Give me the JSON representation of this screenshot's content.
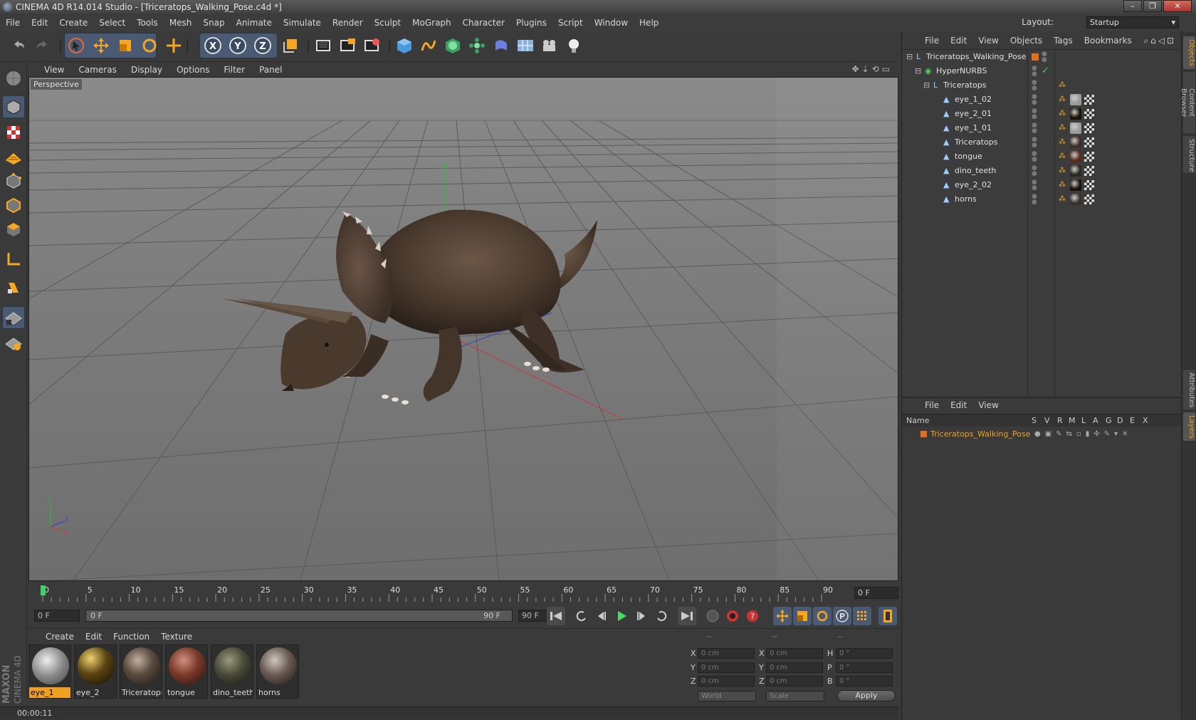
{
  "window": {
    "title": "CINEMA 4D R14.014 Studio - [Triceratops_Walking_Pose.c4d *]",
    "buttons": [
      "–",
      "❐",
      "✕"
    ]
  },
  "menubar": {
    "items": [
      "File",
      "Edit",
      "Create",
      "Select",
      "Tools",
      "Mesh",
      "Snap",
      "Animate",
      "Simulate",
      "Render",
      "Sculpt",
      "MoGraph",
      "Character",
      "Plugins",
      "Script",
      "Window",
      "Help"
    ],
    "layout_label": "Layout:",
    "layout_value": "Startup"
  },
  "toolbar": {
    "axis_labels": [
      "X",
      "Y",
      "Z"
    ],
    "icons": [
      "undo-icon",
      "redo-icon",
      "select-arrow-icon",
      "move-icon",
      "scale-icon",
      "rotate-icon",
      "live-select-icon",
      "x-axis-icon",
      "y-axis-icon",
      "z-axis-icon",
      "coordinate-system-icon",
      "render-view-icon",
      "render-picture-viewer-icon",
      "render-settings-icon",
      "cube-icon",
      "spline-icon",
      "nurbs-icon",
      "array-icon",
      "deformer-icon",
      "floor-icon",
      "camera-icon",
      "light-icon"
    ]
  },
  "viewport": {
    "menu": [
      "View",
      "Cameras",
      "Display",
      "Options",
      "Filter",
      "Panel"
    ],
    "label": "Perspective",
    "axis_x": "X",
    "axis_y": "Y",
    "axis_z": "Z"
  },
  "timeline": {
    "ticks": [
      "0",
      "5",
      "10",
      "15",
      "20",
      "25",
      "30",
      "35",
      "40",
      "45",
      "50",
      "55",
      "60",
      "65",
      "70",
      "75",
      "80",
      "85",
      "90"
    ],
    "current_frame_box": "0 F"
  },
  "transport": {
    "start_field": "0 F",
    "range_start": "0 F",
    "range_end": "90 F",
    "end_field": "90 F"
  },
  "materials": {
    "menu": [
      "Create",
      "Edit",
      "Function",
      "Texture"
    ],
    "items": [
      {
        "name": "eye_1",
        "selected": true
      },
      {
        "name": "eye_2",
        "selected": false
      },
      {
        "name": "Triceratops",
        "selected": false
      },
      {
        "name": "tongue",
        "selected": false
      },
      {
        "name": "dino_teeth",
        "selected": false
      },
      {
        "name": "horns",
        "selected": false
      }
    ]
  },
  "coordinates": {
    "headers": [
      "--",
      "--",
      "--"
    ],
    "rows": [
      {
        "l1": "X",
        "v1": "0 cm",
        "l2": "X",
        "v2": "0 cm",
        "l3": "H",
        "v3": "0 °"
      },
      {
        "l1": "Y",
        "v1": "0 cm",
        "l2": "Y",
        "v2": "0 cm",
        "l3": "P",
        "v3": "0 °"
      },
      {
        "l1": "Z",
        "v1": "0 cm",
        "l2": "Z",
        "v2": "0 cm",
        "l3": "B",
        "v3": "0 °"
      }
    ],
    "world": "World",
    "scale": "Scale",
    "apply": "Apply"
  },
  "status": {
    "time": "00:00:11"
  },
  "branding": {
    "maxon": "MAXON",
    "cinema": "CINEMA 4D"
  },
  "objects": {
    "menu": [
      "File",
      "Edit",
      "View",
      "Objects",
      "Tags",
      "Bookmarks"
    ],
    "tree": [
      {
        "name": "Triceratops_Walking_Pose",
        "level": 0
      },
      {
        "name": "HyperNURBS",
        "level": 1
      },
      {
        "name": "Triceratops",
        "level": 2
      },
      {
        "name": "eye_1_02",
        "level": 3
      },
      {
        "name": "eye_2_01",
        "level": 3
      },
      {
        "name": "eye_1_01",
        "level": 3
      },
      {
        "name": "Triceratops",
        "level": 3
      },
      {
        "name": "tongue",
        "level": 3
      },
      {
        "name": "dino_teeth",
        "level": 3
      },
      {
        "name": "eye_2_02",
        "level": 3
      },
      {
        "name": "horns",
        "level": 3
      }
    ]
  },
  "layers": {
    "menu": [
      "File",
      "Edit",
      "View"
    ],
    "columns": [
      "Name",
      "S",
      "V",
      "R",
      "M",
      "L",
      "A",
      "G",
      "D",
      "E",
      "X"
    ],
    "row": "Triceratops_Walking_Pose"
  },
  "sidetabs": [
    "Objects",
    "Content Browser",
    "Structure",
    "Attributes",
    "Layers"
  ],
  "colors": {
    "accent": "#f0a020",
    "selection": "#4a5a72"
  }
}
